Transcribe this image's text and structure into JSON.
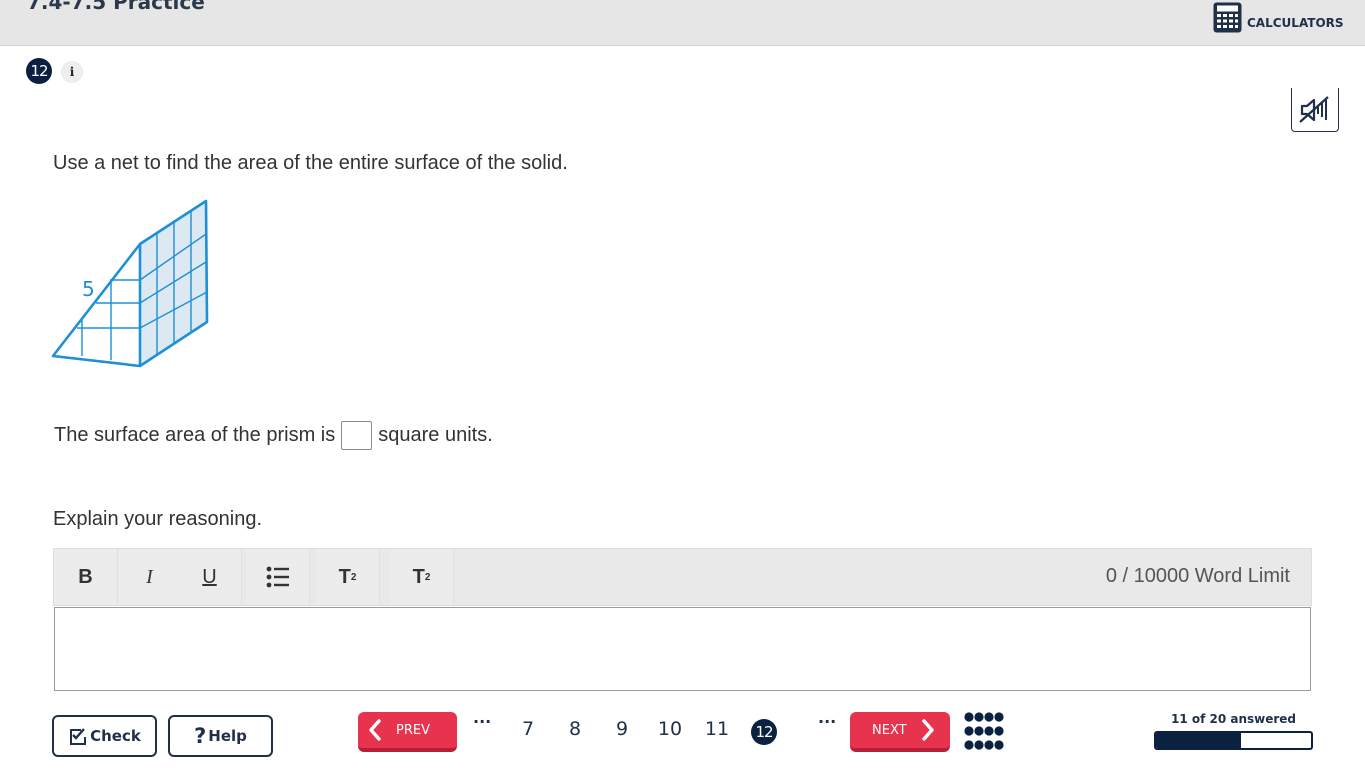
{
  "header": {
    "title": "7.4-7.5 Practice",
    "calculators_label": "CALCULATORS"
  },
  "question": {
    "number": "12",
    "info_icon": "i",
    "audio_icon": "speaker-muted-icon",
    "prompt": "Use a net to find the area of the entire surface of the solid.",
    "figure_label": "5",
    "answer_prefix": "The surface area of the prism is",
    "answer_value": "",
    "answer_suffix": "square units.",
    "explain_prompt": "Explain your reasoning."
  },
  "editor": {
    "bold": "B",
    "italic": "I",
    "underline": "U",
    "list_icon": "bullet-list-icon",
    "superscript": "T",
    "superscript_mark": "2",
    "subscript": "T",
    "subscript_mark": "2",
    "word_count": "0",
    "word_limit": "/ 10000 Word Limit",
    "content": ""
  },
  "footer": {
    "check_label": "Check",
    "help_q": "?",
    "help_label": "Help",
    "prev_label": "PREV",
    "next_label": "NEXT",
    "ellipsis_left": "···",
    "ellipsis_right": "···",
    "pages": [
      "7",
      "8",
      "9",
      "10",
      "11"
    ],
    "current_page": "12",
    "progress_text": "11 of 20 answered",
    "answered": 11,
    "total": 20
  },
  "colors": {
    "navy": "#0a2240",
    "nav_red": "#e8334f",
    "figure_blue": "#1f8fd6",
    "header_gray": "#e6e6e6"
  }
}
